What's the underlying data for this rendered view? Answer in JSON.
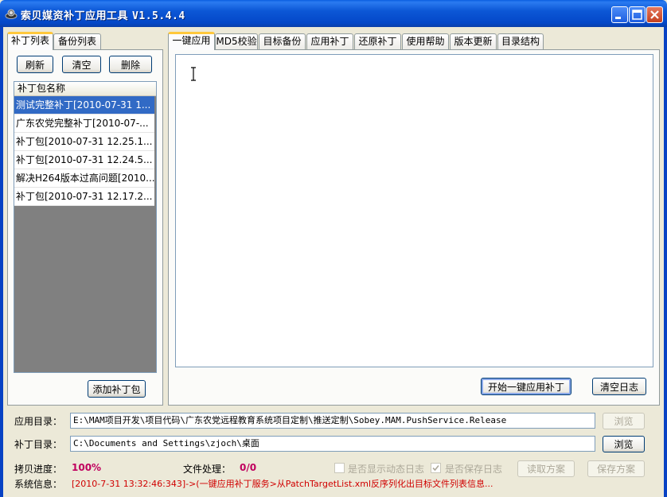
{
  "window": {
    "title": "索贝媒资补丁应用工具",
    "version": "V1.5.4.4"
  },
  "left_tabs": [
    {
      "label": "补丁列表"
    },
    {
      "label": "备份列表"
    }
  ],
  "left_buttons": {
    "refresh": "刷新",
    "clear": "清空",
    "delete": "删除",
    "add_patch": "添加补丁包"
  },
  "patch_list": {
    "header": "补丁包名称",
    "items": [
      "测试完整补丁[2010-07-31 1...",
      "广东农党完整补丁[2010-07-...",
      "补丁包[2010-07-31 12.25.1...",
      "补丁包[2010-07-31 12.24.5...",
      "解决H264版本过高问题[2010...",
      "补丁包[2010-07-31 12.17.2..."
    ],
    "selected_index": 0
  },
  "right_tabs": [
    {
      "label": "一键应用"
    },
    {
      "label": "MD5校验"
    },
    {
      "label": "目标备份"
    },
    {
      "label": "应用补丁"
    },
    {
      "label": "还原补丁"
    },
    {
      "label": "使用帮助"
    },
    {
      "label": "版本更新"
    },
    {
      "label": "目录结构"
    }
  ],
  "main": {
    "log_text": "",
    "start_button": "开始一键应用补丁",
    "clear_log_button": "清空日志"
  },
  "bottom": {
    "app_dir_label": "应用目录：",
    "app_dir_value": "E:\\MAM项目开发\\项目代码\\广东农党远程教育系统项目定制\\推送定制\\Sobey.MAM.PushService.Release",
    "app_dir_browse": "浏览",
    "patch_dir_label": "补丁目录：",
    "patch_dir_value": "C:\\Documents and Settings\\zjoch\\桌面",
    "patch_dir_browse": "浏览",
    "copy_progress_label": "拷贝进度：",
    "copy_progress_value": "100%",
    "file_process_label": "文件处理：",
    "file_process_value": "0/0",
    "show_dynamic_log": "是否显示动态日志",
    "show_dynamic_log_checked": false,
    "save_log": "是否保存日志",
    "save_log_checked": true,
    "read_scheme": "读取方案",
    "save_scheme": "保存方案",
    "sys_info_label": "系统信息：",
    "sys_info_value": "[2010-7-31 13:32:46:343]->(一键应用补丁服务>从PatchTargetList.xml反序列化出目标文件列表信息..."
  },
  "colors": {
    "title_bar": "#0a5fe0",
    "selection": "#316ac5",
    "status_red": "#d00000",
    "progress_pink": "#c0005e"
  }
}
